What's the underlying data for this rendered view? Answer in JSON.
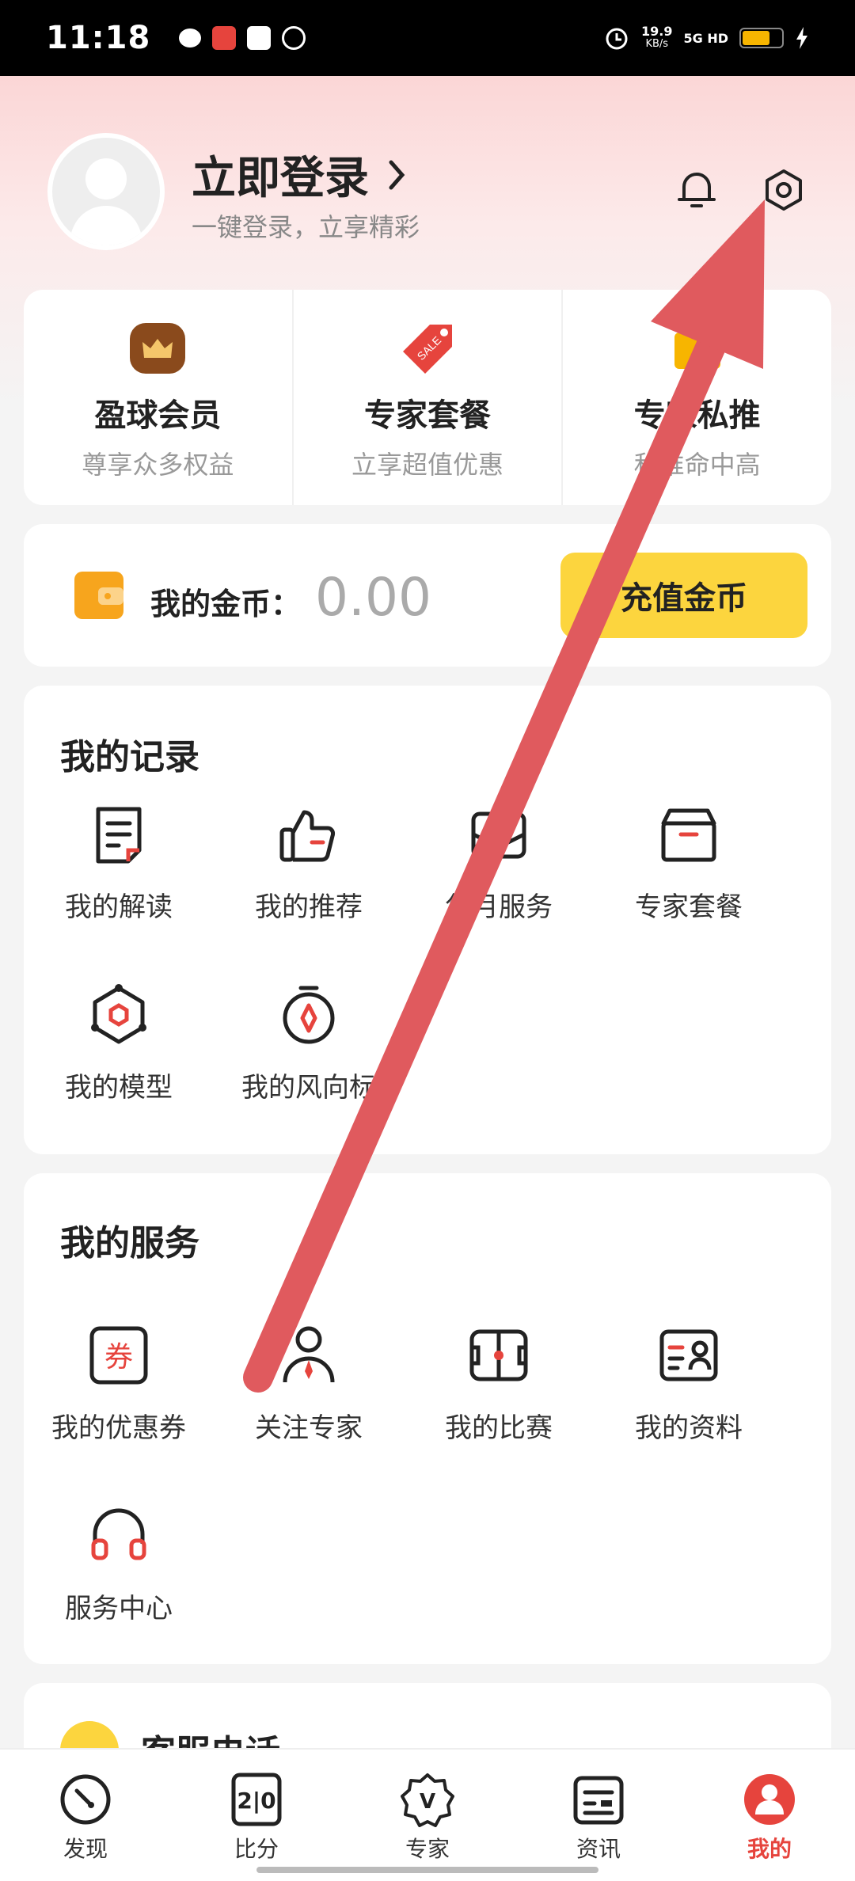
{
  "status_bar": {
    "time": "11:18",
    "network_speed": "19.9",
    "network_unit": "KB/s",
    "network_type": "5G HD"
  },
  "profile": {
    "login_title": "立即登录",
    "login_subtitle": "一键登录，立享精彩"
  },
  "top_cards": [
    {
      "title": "盈球会员",
      "subtitle": "尊享众多权益"
    },
    {
      "title": "专家套餐",
      "subtitle": "立享超值优惠"
    },
    {
      "title": "专家私推",
      "subtitle": "私推命中高"
    }
  ],
  "coins": {
    "label": "我的金币：",
    "value": "0.00",
    "recharge_label": "充值金币"
  },
  "records": {
    "title": "我的记录",
    "items": [
      {
        "label": "我的解读",
        "icon": "document-icon"
      },
      {
        "label": "我的推荐",
        "icon": "thumbs-up-icon"
      },
      {
        "label": "包月服务",
        "icon": "envelope-icon"
      },
      {
        "label": "专家套餐",
        "icon": "box-icon"
      },
      {
        "label": "我的模型",
        "icon": "hexagon-model-icon"
      },
      {
        "label": "我的风向标",
        "icon": "compass-icon"
      }
    ]
  },
  "services": {
    "title": "我的服务",
    "items": [
      {
        "label": "我的优惠券",
        "icon": "coupon-icon",
        "icon_text": "券"
      },
      {
        "label": "关注专家",
        "icon": "expert-icon"
      },
      {
        "label": "我的比赛",
        "icon": "pitch-icon"
      },
      {
        "label": "我的资料",
        "icon": "profile-card-icon"
      },
      {
        "label": "服务中心",
        "icon": "headset-icon"
      }
    ]
  },
  "phone": {
    "label": "客服电话"
  },
  "tabbar": [
    {
      "label": "发现",
      "icon": "discover-icon",
      "active": false
    },
    {
      "label": "比分",
      "icon": "score-icon",
      "icon_text": "2|0",
      "active": false
    },
    {
      "label": "专家",
      "icon": "expert-badge-icon",
      "icon_text": "V",
      "active": false
    },
    {
      "label": "资讯",
      "icon": "news-icon",
      "active": false
    },
    {
      "label": "我的",
      "icon": "me-icon",
      "active": true
    }
  ],
  "colors": {
    "accent_red": "#e6443d",
    "recharge_yellow": "#fcd53e",
    "annotation_arrow": "#e05a5e"
  }
}
